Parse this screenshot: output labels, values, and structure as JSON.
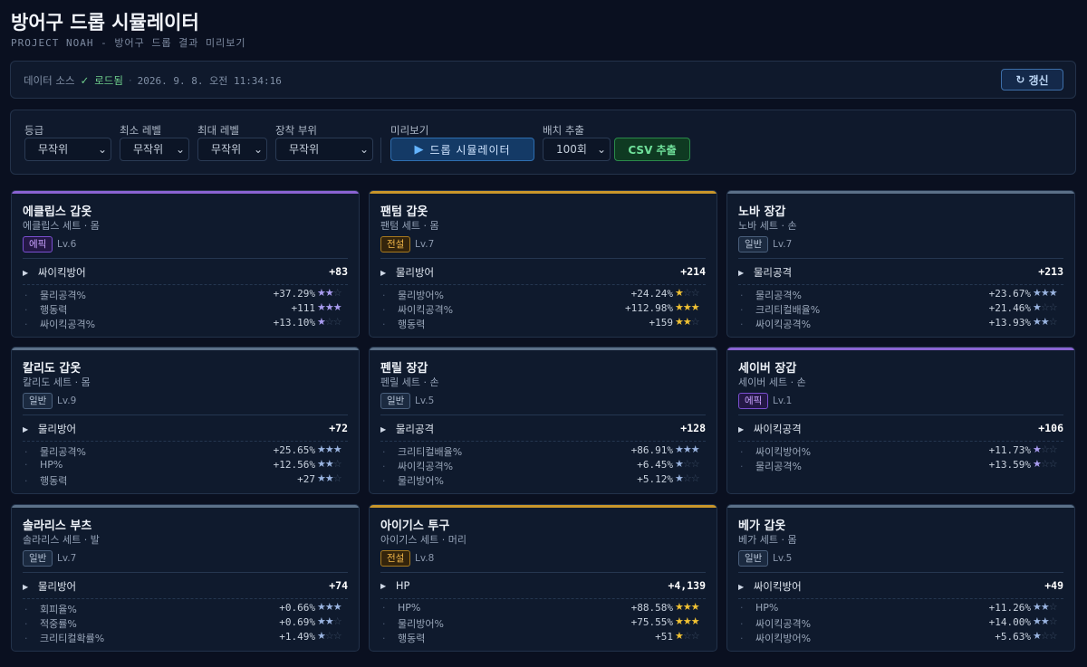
{
  "header": {
    "title": "방어구 드롭 시뮬레이터",
    "subtitle": "PROJECT NOAH - 방어구 드롭 결과 미리보기"
  },
  "source": {
    "label": "데이터 소스",
    "status_icon": "✓",
    "status": "로드됨",
    "separator": "·",
    "timestamp": "2026. 9. 8. 오전 11:34:16",
    "refresh_icon": "↻",
    "refresh_label": "갱신"
  },
  "filters": {
    "grade_label": "등급",
    "grade_value": "무작위",
    "min_level_label": "최소 레벨",
    "min_level_value": "무작위",
    "max_level_label": "최대 레벨",
    "max_level_value": "무작위",
    "slot_label": "장착 부위",
    "slot_value": "무작위",
    "preview_label": "미리보기",
    "simulate_icon": "▶",
    "simulate_button": "드롭 시뮬레이터",
    "batch_label": "배치 추출",
    "batch_value": "100회",
    "csv_button": "CSV 추출",
    "caret": "⌄"
  },
  "colors": {
    "epic": "#8a63d2",
    "legend": "#c9962a",
    "normal": "#5b7088"
  },
  "cards": [
    {
      "name": "에클립스 갑옷",
      "set": "에클립스 세트 · 몸",
      "grade": "에픽",
      "grade_class": "epic",
      "level": "Lv.6",
      "main_stat": "싸이킥방어",
      "main_value": "+83",
      "subs": [
        {
          "name": "물리공격%",
          "value": "+37.29%",
          "stars": 2
        },
        {
          "name": "행동력",
          "value": "+111",
          "stars": 3
        },
        {
          "name": "싸이킥공격%",
          "value": "+13.10%",
          "stars": 1
        }
      ]
    },
    {
      "name": "팬텀 갑옷",
      "set": "팬텀 세트 · 몸",
      "grade": "전설",
      "grade_class": "legend",
      "level": "Lv.7",
      "main_stat": "물리방어",
      "main_value": "+214",
      "subs": [
        {
          "name": "물리방어%",
          "value": "+24.24%",
          "stars": 1
        },
        {
          "name": "싸이킥공격%",
          "value": "+112.98%",
          "stars": 3
        },
        {
          "name": "행동력",
          "value": "+159",
          "stars": 2
        }
      ]
    },
    {
      "name": "노바 장갑",
      "set": "노바 세트 · 손",
      "grade": "일반",
      "grade_class": "normal",
      "level": "Lv.7",
      "main_stat": "물리공격",
      "main_value": "+213",
      "subs": [
        {
          "name": "물리공격%",
          "value": "+23.67%",
          "stars": 3
        },
        {
          "name": "크리티컬배율%",
          "value": "+21.46%",
          "stars": 1
        },
        {
          "name": "싸이킥공격%",
          "value": "+13.93%",
          "stars": 2
        }
      ]
    },
    {
      "name": "칼리도 갑옷",
      "set": "칼리도 세트 · 몸",
      "grade": "일반",
      "grade_class": "normal",
      "level": "Lv.9",
      "main_stat": "물리방어",
      "main_value": "+72",
      "subs": [
        {
          "name": "물리공격%",
          "value": "+25.65%",
          "stars": 3
        },
        {
          "name": "HP%",
          "value": "+12.56%",
          "stars": 2
        },
        {
          "name": "행동력",
          "value": "+27",
          "stars": 2
        }
      ]
    },
    {
      "name": "펜릴 장갑",
      "set": "펜릴 세트 · 손",
      "grade": "일반",
      "grade_class": "normal",
      "level": "Lv.5",
      "main_stat": "물리공격",
      "main_value": "+128",
      "subs": [
        {
          "name": "크리티컬배율%",
          "value": "+86.91%",
          "stars": 3
        },
        {
          "name": "싸이킥공격%",
          "value": "+6.45%",
          "stars": 1
        },
        {
          "name": "물리방어%",
          "value": "+5.12%",
          "stars": 1
        }
      ]
    },
    {
      "name": "세이버 장갑",
      "set": "세이버 세트 · 손",
      "grade": "에픽",
      "grade_class": "epic",
      "level": "Lv.1",
      "main_stat": "싸이킥공격",
      "main_value": "+106",
      "subs": [
        {
          "name": "싸이킥방어%",
          "value": "+11.73%",
          "stars": 1
        },
        {
          "name": "물리공격%",
          "value": "+13.59%",
          "stars": 1
        }
      ]
    },
    {
      "name": "솔라리스 부츠",
      "set": "솔라리스 세트 · 발",
      "grade": "일반",
      "grade_class": "normal",
      "level": "Lv.7",
      "main_stat": "물리방어",
      "main_value": "+74",
      "subs": [
        {
          "name": "회피율%",
          "value": "+0.66%",
          "stars": 3
        },
        {
          "name": "적중률%",
          "value": "+0.69%",
          "stars": 2
        },
        {
          "name": "크리티컬확률%",
          "value": "+1.49%",
          "stars": 1
        }
      ]
    },
    {
      "name": "아이기스 투구",
      "set": "아이기스 세트 · 머리",
      "grade": "전설",
      "grade_class": "legend",
      "level": "Lv.8",
      "main_stat": "HP",
      "main_value": "+4,139",
      "subs": [
        {
          "name": "HP%",
          "value": "+88.58%",
          "stars": 3
        },
        {
          "name": "물리방어%",
          "value": "+75.55%",
          "stars": 3
        },
        {
          "name": "행동력",
          "value": "+51",
          "stars": 1
        }
      ]
    },
    {
      "name": "베가 갑옷",
      "set": "베가 세트 · 몸",
      "grade": "일반",
      "grade_class": "normal",
      "level": "Lv.5",
      "main_stat": "싸이킥방어",
      "main_value": "+49",
      "subs": [
        {
          "name": "HP%",
          "value": "+11.26%",
          "stars": 2
        },
        {
          "name": "싸이킥공격%",
          "value": "+14.00%",
          "stars": 2
        },
        {
          "name": "싸이킥방어%",
          "value": "+5.63%",
          "stars": 1
        }
      ]
    }
  ]
}
